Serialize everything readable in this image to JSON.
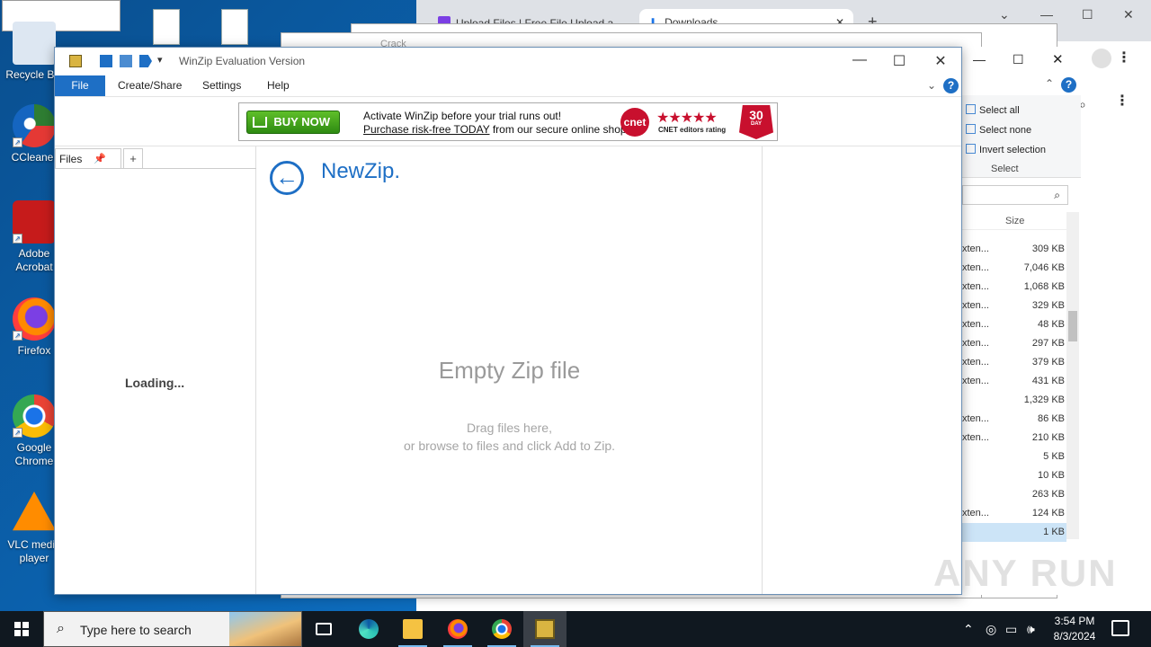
{
  "desktop": {
    "icons": [
      {
        "label": "Recycle Bin",
        "icon": "recycle-bin-icon"
      },
      {
        "label": "CCleaner",
        "icon": "ccleaner-icon"
      },
      {
        "label": "Adobe Acrobat",
        "icon": "acrobat-icon"
      },
      {
        "label": "Firefox",
        "icon": "firefox-icon"
      },
      {
        "label": "Google Chrome",
        "icon": "chrome-icon"
      },
      {
        "label": "VLC media player",
        "icon": "vlc-icon"
      }
    ]
  },
  "browser": {
    "tabs": [
      {
        "label": "Upload Files | Free File Upload a..."
      },
      {
        "label": "Downloads"
      }
    ],
    "explorer_title": "Crack"
  },
  "explorer": {
    "select_group": {
      "select_all": "Select all",
      "select_none": "Select none",
      "invert_selection": "Invert selection",
      "group_label": "Select"
    },
    "size_header": "Size",
    "rows": [
      {
        "type": "xten...",
        "size": "309 KB"
      },
      {
        "type": "xten...",
        "size": "7,046 KB"
      },
      {
        "type": "xten...",
        "size": "1,068 KB"
      },
      {
        "type": "xten...",
        "size": "329 KB"
      },
      {
        "type": "xten...",
        "size": "48 KB"
      },
      {
        "type": "xten...",
        "size": "297 KB"
      },
      {
        "type": "xten...",
        "size": "379 KB"
      },
      {
        "type": "xten...",
        "size": "431 KB"
      },
      {
        "type": "",
        "size": "1,329 KB"
      },
      {
        "type": "xten...",
        "size": "86 KB"
      },
      {
        "type": "xten...",
        "size": "210 KB"
      },
      {
        "type": "",
        "size": "5 KB"
      },
      {
        "type": "",
        "size": "10 KB"
      },
      {
        "type": "",
        "size": "263 KB"
      },
      {
        "type": "xten...",
        "size": "124 KB"
      },
      {
        "type": "",
        "size": "1 KB"
      }
    ]
  },
  "winzip": {
    "title": "WinZip Evaluation Version",
    "menu": {
      "file": "File",
      "create_share": "Create/Share",
      "settings": "Settings",
      "help": "Help"
    },
    "banner": {
      "buy_now": "BUY NOW",
      "line1": "Activate WinZip before your trial runs out!",
      "line2_link": "Purchase risk-free TODAY",
      "line2_rest": " from our secure online shop.",
      "cnet": "cnet",
      "cnet_rating": "CNET editors rating",
      "guarantee_days": "30",
      "guarantee_label": "DAY"
    },
    "files_tab": "Files",
    "add_tab": "+",
    "loading": "Loading...",
    "newzip_title": "NewZip.",
    "empty_title": "Empty Zip file",
    "drag_line1": "Drag files here,",
    "drag_line2": "or browse to files and click Add to Zip."
  },
  "watermark": "ANY RUN",
  "taskbar": {
    "search_placeholder": "Type here to search",
    "time": "3:54 PM",
    "date": "8/3/2024"
  }
}
